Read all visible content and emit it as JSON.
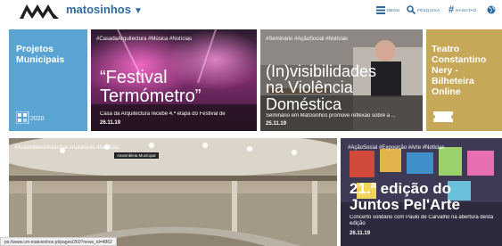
{
  "header": {
    "brand": "matosinhos",
    "nav": [
      {
        "label": "MENU",
        "icon": "menu-icon"
      },
      {
        "label": "PESQUISA",
        "icon": "search-icon"
      },
      {
        "label": "HASHTAG",
        "icon": "hashtag-icon"
      },
      {
        "label": "",
        "icon": "globe-icon"
      }
    ]
  },
  "tiles": {
    "projetos": {
      "title_line1": "Projetos",
      "title_line2": "Municipais",
      "badge": "2020"
    },
    "festival": {
      "tags": "#CasadaArquitectura #Música #Notícias",
      "title_line1": "“Festival",
      "title_line2": "Termómetro”",
      "caption": "Casa da Arquitectura recebe 4.ª etapa do Festival de",
      "date": "26.11.19"
    },
    "visibilidades": {
      "tags": "#Seminário #AçãoSocial #Notícias",
      "title_line1": "(In)visibilidades",
      "title_line2": "na Violência",
      "title_line3": "Doméstica",
      "caption": "Seminário em Matosinhos promove reflexão sobre a ...",
      "date": "25.11.19"
    },
    "teatro": {
      "title_line1": "Teatro",
      "title_line2": "Constantino",
      "title_line3": "Nery -",
      "title_line4": "Bilheteira",
      "title_line5": "Online"
    },
    "assembleia": {
      "tags": "#AssembleiaMunicipal #Autarquia #Notícias",
      "pill": "Assembleia Municipal"
    },
    "juntos": {
      "tags": "#AçãoSocial #Exposição #Arte #Notícias",
      "title_line1": "21.ª edição do",
      "title_line2": "Juntos Pel'Arte",
      "caption": "Concerto solidário com Paulo de Carvalho na abertura desta edição",
      "date": "26.11.19"
    }
  },
  "statusbar": "ps://www.cm-matosinhos.pt/pages/260?news_id=4862",
  "colors": {
    "brand": "#2d6aa3",
    "projetos": "#5aa4d4",
    "teatro": "#c7a758"
  }
}
